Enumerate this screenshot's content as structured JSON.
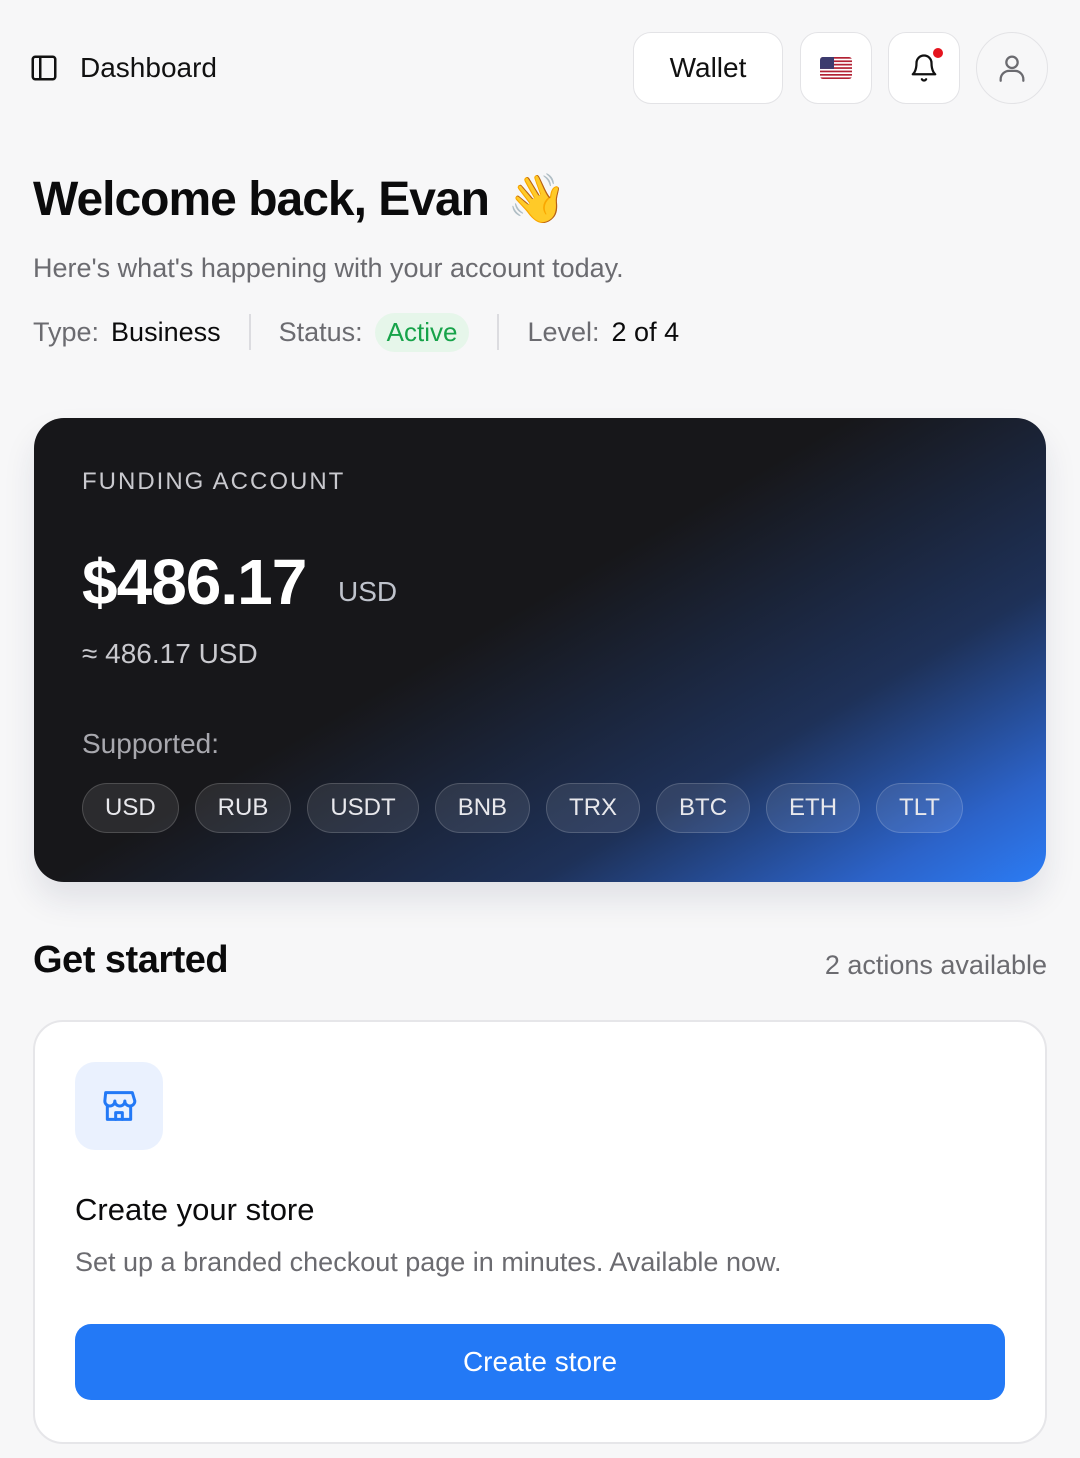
{
  "header": {
    "page_title": "Dashboard",
    "wallet_label": "Wallet",
    "language_icon": "us-flag-icon",
    "notification_icon": "bell-icon",
    "has_notification": true,
    "profile_icon": "user-icon"
  },
  "welcome": {
    "title": "Welcome back, Evan",
    "emoji": "👋",
    "subtitle": "Here's what's happening with your account today."
  },
  "account_meta": {
    "type_label": "Type:",
    "type_value": "Business",
    "status_label": "Status:",
    "status_value": "Active",
    "level_label": "Level:",
    "level_value": "2 of 4"
  },
  "funding": {
    "label": "FUNDING ACCOUNT",
    "amount": "$486.17",
    "currency": "USD",
    "approx": "≈ 486.17 USD",
    "supported_label": "Supported:",
    "supported": [
      "USD",
      "RUB",
      "USDT",
      "BNB",
      "TRX",
      "BTC",
      "ETH",
      "TLT"
    ]
  },
  "get_started": {
    "title": "Get started",
    "count_text": "2 actions available",
    "cards": [
      {
        "icon": "store-icon",
        "title": "Create your store",
        "description": "Set up a branded checkout page in minutes. Available now.",
        "button_label": "Create store"
      }
    ]
  },
  "colors": {
    "accent": "#2379f6",
    "status_active_bg": "#e6f6ea",
    "status_active_text": "#17a34a",
    "notification_dot": "#e5141e"
  }
}
